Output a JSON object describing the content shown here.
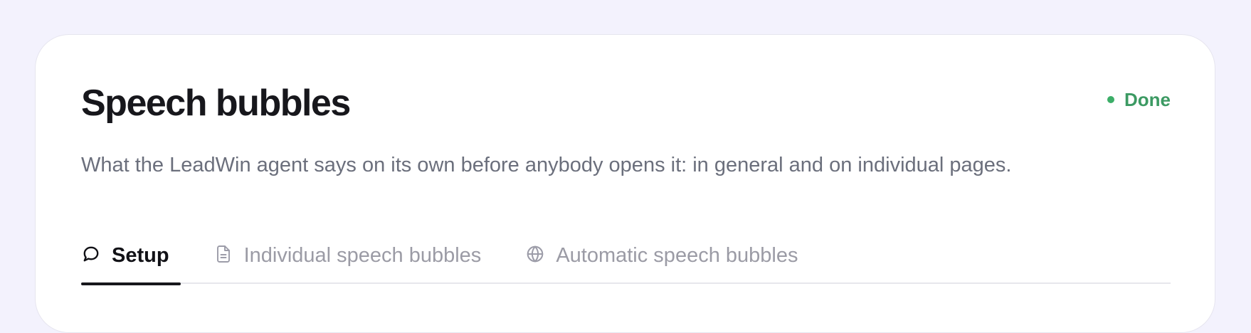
{
  "header": {
    "title": "Speech bubbles",
    "subtitle": "What the LeadWin agent says on its own before anybody opens it: in general and on individual pages."
  },
  "status": {
    "label": "Done",
    "color": "#3cae68",
    "icon": "status-dot-icon"
  },
  "tabs": [
    {
      "label": "Setup",
      "icon": "speech-bubble-icon",
      "active": true
    },
    {
      "label": "Individual speech bubbles",
      "icon": "document-icon",
      "active": false
    },
    {
      "label": "Automatic speech bubbles",
      "icon": "globe-icon",
      "active": false
    }
  ],
  "colors": {
    "background": "#f3f2fd",
    "card": "#ffffff",
    "accent_green": "#3c9a63",
    "active_tab": "#17171c"
  }
}
